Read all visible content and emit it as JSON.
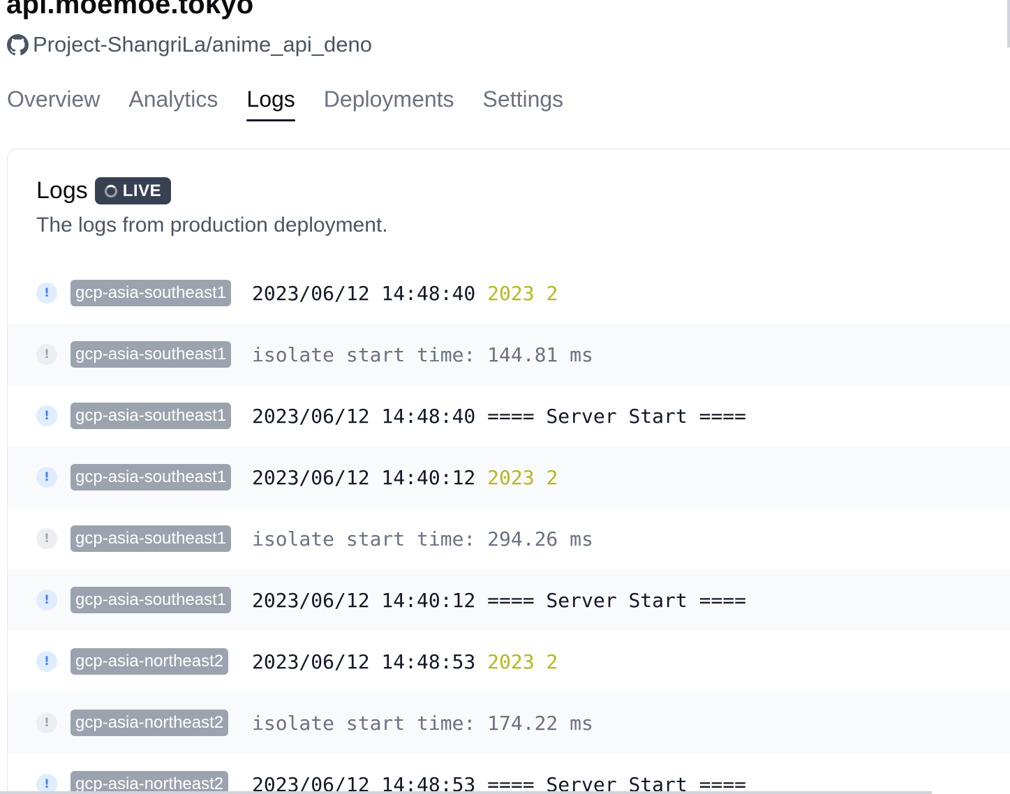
{
  "header": {
    "project_title": "api.moemoe.tokyo",
    "repo": "Project-ShangriLa/anime_api_deno",
    "repo_icon": "github-icon"
  },
  "tabs": [
    {
      "label": "Overview",
      "active": false
    },
    {
      "label": "Analytics",
      "active": false
    },
    {
      "label": "Logs",
      "active": true
    },
    {
      "label": "Deployments",
      "active": false
    },
    {
      "label": "Settings",
      "active": false
    }
  ],
  "logs_card": {
    "title": "Logs",
    "live_label": "LIVE",
    "subtitle": "The logs from production deployment."
  },
  "log_entries": [
    {
      "level": "info",
      "region": "gcp-asia-southeast1",
      "text": "2023/06/12 14:48:40 ",
      "highlight": "2023 2"
    },
    {
      "level": "debug",
      "region": "gcp-asia-southeast1",
      "text": "isolate start time: 144.81 ms",
      "highlight": ""
    },
    {
      "level": "info",
      "region": "gcp-asia-southeast1",
      "text": "2023/06/12 14:48:40 ==== Server Start ====",
      "highlight": ""
    },
    {
      "level": "info",
      "region": "gcp-asia-southeast1",
      "text": "2023/06/12 14:40:12 ",
      "highlight": "2023 2"
    },
    {
      "level": "debug",
      "region": "gcp-asia-southeast1",
      "text": "isolate start time: 294.26 ms",
      "highlight": ""
    },
    {
      "level": "info",
      "region": "gcp-asia-southeast1",
      "text": "2023/06/12 14:40:12 ==== Server Start ====",
      "highlight": ""
    },
    {
      "level": "info",
      "region": "gcp-asia-northeast2",
      "text": "2023/06/12 14:48:53 ",
      "highlight": "2023 2"
    },
    {
      "level": "debug",
      "region": "gcp-asia-northeast2",
      "text": "isolate start time: 174.22 ms",
      "highlight": ""
    },
    {
      "level": "info",
      "region": "gcp-asia-northeast2",
      "text": "2023/06/12 14:48:53 ==== Server Start ====",
      "highlight": ""
    }
  ],
  "colors": {
    "highlight_number": "#b5b81c",
    "info_icon": "#3b82f6",
    "region_badge": "#9ca3af",
    "live_badge": "#374151"
  }
}
